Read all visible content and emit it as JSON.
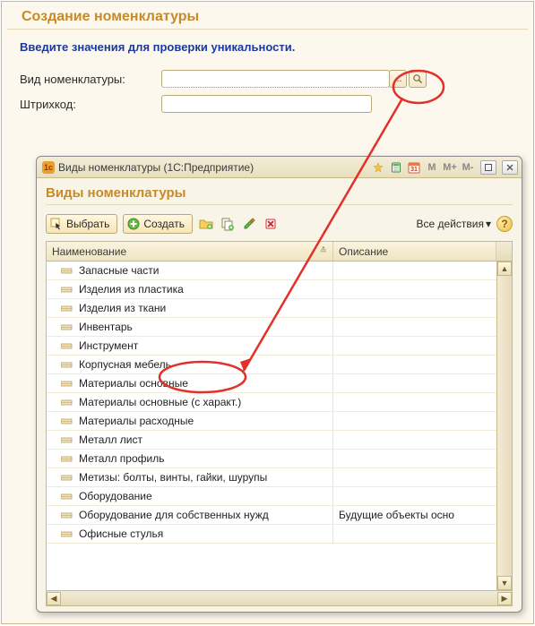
{
  "page": {
    "title": "Создание номенклатуры",
    "instruction": "Введите значения для проверки уникальности."
  },
  "form": {
    "nomtype_label": "Вид номенклатуры:",
    "nomtype_value": "",
    "barcode_label": "Штрихкод:",
    "barcode_value": "",
    "ellipsis": "...",
    "magnifier": "🔍"
  },
  "popup": {
    "titlebar": "Виды номенклатуры  (1С:Предприятие)",
    "heading": "Виды номенклатуры",
    "toolbar": {
      "select": "Выбрать",
      "create": "Создать",
      "all_actions": "Все действия"
    },
    "columns": {
      "name": "Наименование",
      "desc": "Описание"
    },
    "rows": [
      {
        "name": "Запасные части",
        "desc": ""
      },
      {
        "name": "Изделия из пластика",
        "desc": ""
      },
      {
        "name": "Изделия из ткани",
        "desc": ""
      },
      {
        "name": "Инвентарь",
        "desc": ""
      },
      {
        "name": "Инструмент",
        "desc": ""
      },
      {
        "name": "Корпусная мебель",
        "desc": ""
      },
      {
        "name": "Материалы основные",
        "desc": ""
      },
      {
        "name": "Материалы основные (с характ.)",
        "desc": ""
      },
      {
        "name": "Материалы расходные",
        "desc": ""
      },
      {
        "name": "Металл лист",
        "desc": ""
      },
      {
        "name": "Металл профиль",
        "desc": ""
      },
      {
        "name": "Метизы: болты, винты, гайки, шурупы",
        "desc": ""
      },
      {
        "name": "Оборудование",
        "desc": ""
      },
      {
        "name": "Оборудование для собственных нужд",
        "desc": "Будущие объекты осно"
      },
      {
        "name": "Офисные стулья",
        "desc": ""
      }
    ],
    "memory_buttons": {
      "m": "M",
      "mplus": "M+",
      "mminus": "M-"
    }
  }
}
